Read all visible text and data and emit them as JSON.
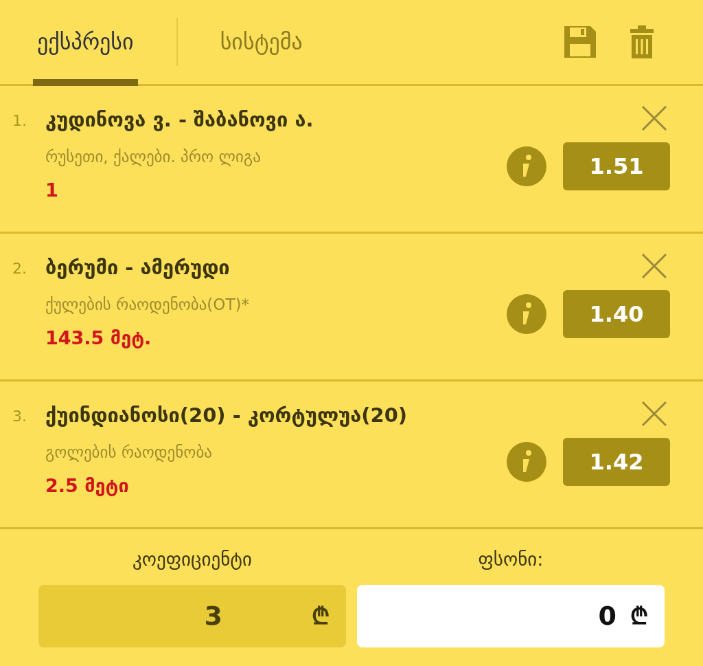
{
  "tabs": [
    {
      "label": "ექსპრესი",
      "selected": true
    },
    {
      "label": "სისტემა",
      "selected": false
    }
  ],
  "bets": [
    {
      "number": "1.",
      "title": "კუდინოვა ვ. - შაბანოვი ა.",
      "market": "რუსეთი, ქალები. პრო ლიგა",
      "pick": "1",
      "odds": "1.51"
    },
    {
      "number": "2.",
      "title": "ბერუმი - ამერუდი",
      "market": "ქულების რაოდენობა(OT)*",
      "pick": "143.5 მეტ.",
      "odds": "1.40"
    },
    {
      "number": "3.",
      "title": "ქუინდიანოსი(20) - კორტულუა(20)",
      "market": "გოლების რაოდენობა",
      "pick": "2.5 მეტი",
      "odds": "1.42"
    }
  ],
  "footer": {
    "coef_label": "კოეფიციენტი",
    "coef_value": "3",
    "coef_currency": "₾",
    "stake_label": "ფსონი:",
    "stake_value": "0",
    "stake_currency": "₾"
  }
}
